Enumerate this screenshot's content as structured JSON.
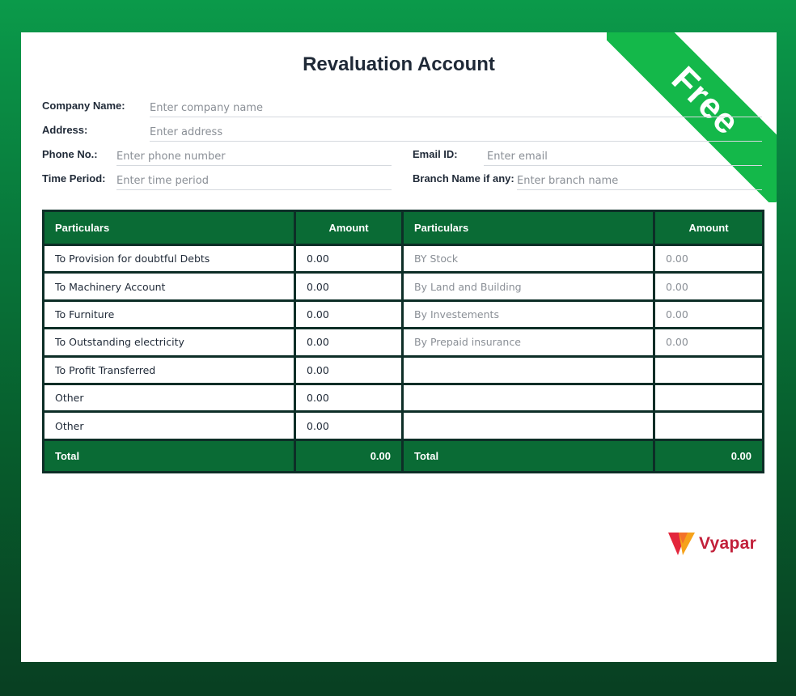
{
  "badge": "Free",
  "title": "Revaluation Account",
  "fields": {
    "company": {
      "label": "Company Name:",
      "placeholder": "Enter company name"
    },
    "address": {
      "label": "Address:",
      "placeholder": "Enter address"
    },
    "phone": {
      "label": "Phone No.:",
      "placeholder": "Enter phone number"
    },
    "email": {
      "label": "Email ID:",
      "placeholder": "Enter email"
    },
    "period": {
      "label": "Time Period:",
      "placeholder": "Enter time period"
    },
    "branch": {
      "label": "Branch Name if any:",
      "placeholder": "Enter branch name"
    }
  },
  "table": {
    "headers": [
      "Particulars",
      "Amount",
      "Particulars",
      "Amount"
    ],
    "rows": [
      [
        "To Provision for doubtful Debts",
        "0.00",
        "BY Stock",
        "0.00"
      ],
      [
        "To Machinery Account",
        "0.00",
        "By Land and Building",
        "0.00"
      ],
      [
        "To Furniture",
        "0.00",
        "By Investements",
        "0.00"
      ],
      [
        "To Outstanding electricity",
        "0.00",
        "By Prepaid insurance",
        "0.00"
      ],
      [
        "To Profit Transferred",
        "0.00",
        "",
        ""
      ],
      [
        "Other",
        "0.00",
        "",
        ""
      ],
      [
        "Other",
        "0.00",
        "",
        ""
      ]
    ],
    "total": [
      "Total",
      "0.00",
      "Total",
      "0.00"
    ]
  },
  "brand": {
    "name": "Vyapar",
    "color": "#c2203a",
    "accent": "#0a6b35"
  }
}
